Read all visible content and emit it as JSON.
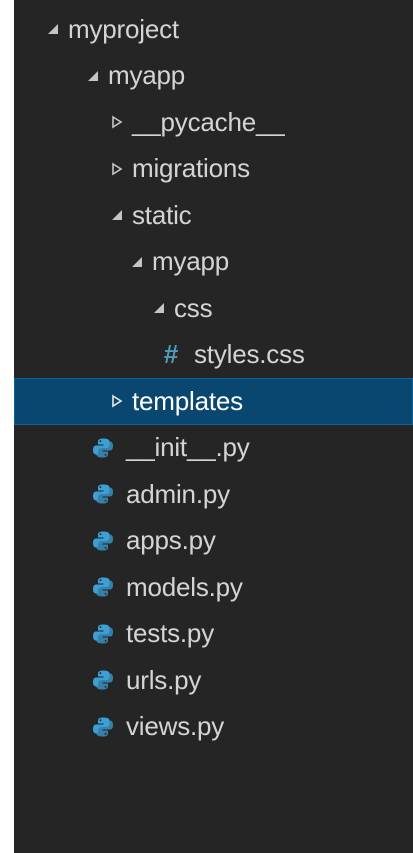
{
  "explorer": {
    "items": [
      {
        "label": "myproject",
        "kind": "folder",
        "state": "expanded",
        "depth": 0
      },
      {
        "label": "myapp",
        "kind": "folder",
        "state": "expanded",
        "depth": 1
      },
      {
        "label": "__pycache__",
        "kind": "folder",
        "state": "collapsed",
        "depth": 2
      },
      {
        "label": "migrations",
        "kind": "folder",
        "state": "collapsed",
        "depth": 2
      },
      {
        "label": "static",
        "kind": "folder",
        "state": "expanded",
        "depth": 2
      },
      {
        "label": "myapp",
        "kind": "folder",
        "state": "expanded",
        "depth": 3
      },
      {
        "label": "css",
        "kind": "folder",
        "state": "expanded",
        "depth": 4
      },
      {
        "label": "styles.css",
        "kind": "css-file",
        "icon": "hash-icon",
        "depth": 5
      },
      {
        "label": "templates",
        "kind": "folder",
        "state": "collapsed",
        "depth": 2,
        "selected": true
      },
      {
        "label": "__init__.py",
        "kind": "python-file",
        "icon": "python-icon",
        "depth": 2
      },
      {
        "label": "admin.py",
        "kind": "python-file",
        "icon": "python-icon",
        "depth": 2
      },
      {
        "label": "apps.py",
        "kind": "python-file",
        "icon": "python-icon",
        "depth": 2
      },
      {
        "label": "models.py",
        "kind": "python-file",
        "icon": "python-icon",
        "depth": 2
      },
      {
        "label": "tests.py",
        "kind": "python-file",
        "icon": "python-icon",
        "depth": 2
      },
      {
        "label": "urls.py",
        "kind": "python-file",
        "icon": "python-icon",
        "depth": 2
      },
      {
        "label": "views.py",
        "kind": "python-file",
        "icon": "python-icon",
        "depth": 2
      }
    ]
  },
  "colors": {
    "background": "#252526",
    "text": "#d4d4d4",
    "selection": "#094771",
    "css_hash": "#519aba",
    "python_icon": "#3c9fd6"
  },
  "css_glyph": "#"
}
